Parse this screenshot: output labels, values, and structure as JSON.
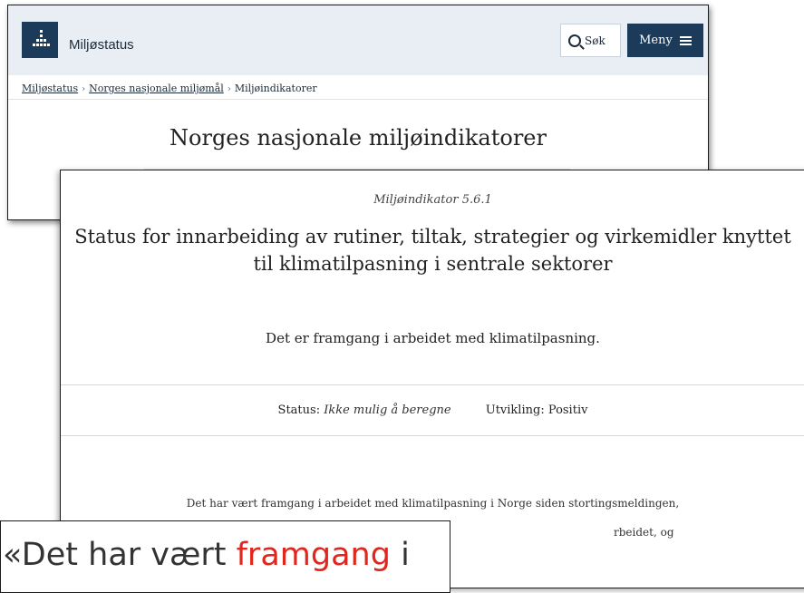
{
  "window_back": {
    "brand": "Miljøstatus",
    "search_label": "Søk",
    "menu_label": "Meny",
    "breadcrumbs": [
      "Miljøstatus",
      "Norges nasjonale miljømål",
      "Miljøindikatorer"
    ],
    "title": "Norges nasjonale miljøindikatorer"
  },
  "window_front": {
    "kicker": "Miljøindikator 5.6.1",
    "headline": "Status for innarbeiding av rutiner, tiltak, strategier og virkemidler knyttet til klimatilpasning i sentrale sektorer",
    "lead": "Det er framgang i arbeidet med klimatilpasning.",
    "status_label": "Status:",
    "status_value": "Ikke mulig å beregne",
    "trend_label": "Utvikling:",
    "trend_value": "Positiv",
    "body_line1": "Det har vært framgang i arbeidet med klimatilpasning i Norge siden stortingsmeldingen,",
    "body_line2": "rbeidet, og"
  },
  "quote": {
    "before": "«Det har vært ",
    "highlight": "framgang",
    "after": " i"
  },
  "colors": {
    "brand_navy": "#1c3b5a",
    "header_bg": "#e9eef5",
    "highlight_red": "#e0261d"
  }
}
